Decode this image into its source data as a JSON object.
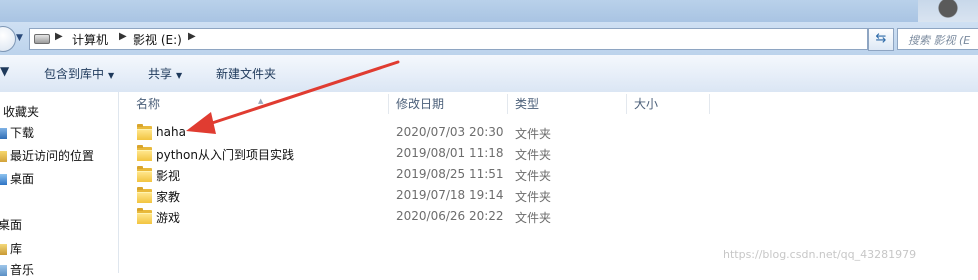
{
  "address": {
    "breadcrumbs": [
      "计算机",
      "影视 (E:)"
    ],
    "search_placeholder": "搜索 影视 (E"
  },
  "toolbar": {
    "items": [
      {
        "label": "包含到库中",
        "has_dropdown": true
      },
      {
        "label": "共享",
        "has_dropdown": true
      },
      {
        "label": "新建文件夹",
        "has_dropdown": false
      }
    ]
  },
  "nav": {
    "items": [
      {
        "label": "收藏夹",
        "icon": "star-icon"
      },
      {
        "label": "下载",
        "icon": "download-folder-icon"
      },
      {
        "label": "最近访问的位置",
        "icon": "recent-places-icon"
      },
      {
        "label": "桌面",
        "icon": "desktop-icon"
      },
      {
        "label": "桌面",
        "icon": "desktop-icon"
      },
      {
        "label": "库",
        "icon": "library-icon"
      },
      {
        "label": "音乐",
        "icon": "music-icon"
      }
    ]
  },
  "columns": [
    "名称",
    "修改日期",
    "类型",
    "大小"
  ],
  "files": [
    {
      "name": "haha",
      "date": "2020/07/03 20:30",
      "type": "文件夹"
    },
    {
      "name": "python从入门到项目实践",
      "date": "2019/08/01 11:18",
      "type": "文件夹"
    },
    {
      "name": "影视",
      "date": "2019/08/25 11:51",
      "type": "文件夹"
    },
    {
      "name": "家教",
      "date": "2019/07/18 19:14",
      "type": "文件夹"
    },
    {
      "name": "游戏",
      "date": "2020/06/26 20:22",
      "type": "文件夹"
    }
  ],
  "watermark": "https://blog.csdn.net/qq_43281979",
  "colors": {
    "annotation_arrow": "#e03c31",
    "folder": "#f2c440",
    "toolbar_text": "#1e395b"
  }
}
